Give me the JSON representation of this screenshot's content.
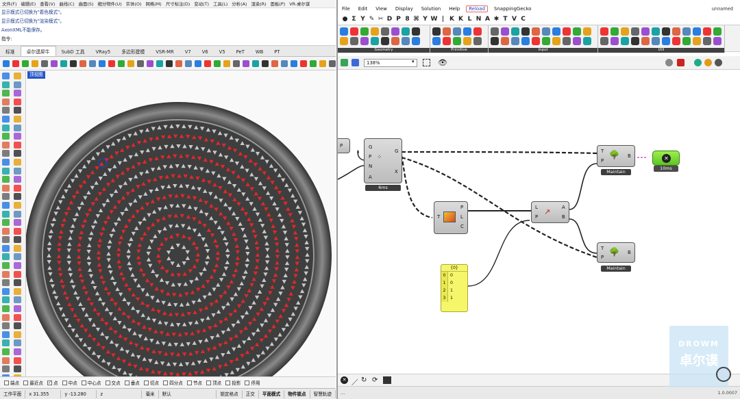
{
  "rhino": {
    "menu": [
      "文件(F)",
      "编辑(E)",
      "查看(V)",
      "曲线(C)",
      "曲面(S)",
      "细分物件(U)",
      "实体(O)",
      "网格(M)",
      "尺寸标注(D)",
      "变动(T)",
      "工具(L)",
      "分析(A)",
      "渲染(R)",
      "面板(P)",
      "VR-桌尔谋"
    ],
    "command_history": [
      "显示模式已切换为\"着色模式\"。",
      "显示模式已切换为\"渲染模式\"。",
      "AxonXML不能保存。"
    ],
    "command_prompt": "指令:",
    "tabs": [
      "标准",
      "卓尔谟犀牛",
      "SubD 工具",
      "VRay5",
      "多边形建模",
      "VSR-MR",
      "V7",
      "V6",
      "V5",
      "PeT",
      "WB",
      "PT"
    ],
    "active_tab": "卓尔谟犀牛",
    "viewport_label": "顶视图",
    "osnaps": [
      {
        "label": "端点",
        "checked": false
      },
      {
        "label": "最近点",
        "checked": false
      },
      {
        "label": "点",
        "checked": true
      },
      {
        "label": "中点",
        "checked": false
      },
      {
        "label": "中心点",
        "checked": false
      },
      {
        "label": "交点",
        "checked": false
      },
      {
        "label": "垂点",
        "checked": false
      },
      {
        "label": "切点",
        "checked": false
      },
      {
        "label": "四分点",
        "checked": false
      },
      {
        "label": "节点",
        "checked": false
      },
      {
        "label": "顶点",
        "checked": false
      },
      {
        "label": "投影",
        "checked": false
      },
      {
        "label": "停用",
        "checked": false
      }
    ],
    "status": {
      "cplane": "工作平面",
      "x": "x 31.355",
      "y": "y -13.280",
      "z": "z",
      "units": "毫米",
      "layer": "默认",
      "items": [
        "锁定格点",
        "正交",
        "平面模式",
        "物件锁点",
        "智慧轨迹"
      ]
    }
  },
  "gh": {
    "menu": [
      "File",
      "Edit",
      "View",
      "Display",
      "Solution",
      "Help",
      "Reload",
      "SnappingGecko"
    ],
    "doc_name": "unnamed",
    "comp_tabs": [
      "●",
      "Σ",
      "Y",
      "✎",
      "✂",
      "D",
      "P",
      "8",
      "⌘",
      "Y",
      "W",
      "|",
      "K",
      "K",
      "L",
      "N",
      "A",
      "✱",
      "T",
      "V",
      "C"
    ],
    "panels": [
      "Geometry",
      "Primitive",
      "Input",
      "Util"
    ],
    "zoom": "138%",
    "version": "1.0.0007",
    "footer_dots": "...",
    "components": {
      "pop": {
        "inputs": [
          "G",
          "P",
          "N",
          "A"
        ],
        "outputs": [
          "G",
          "X"
        ],
        "time": "6ms"
      },
      "gradient": {
        "inputs": [
          "T"
        ],
        "outputs": [
          "P",
          "L",
          "C"
        ]
      },
      "pick": {
        "inputs": [
          "L",
          "P"
        ],
        "outputs": [
          "A",
          "B"
        ]
      },
      "maintain1": {
        "inputs": [
          "T",
          "P"
        ],
        "outputs": [
          "B"
        ],
        "caption": "Maintain"
      },
      "maintain2": {
        "inputs": [
          "T",
          "P"
        ],
        "outputs": [
          "B"
        ],
        "caption": "Maintain"
      },
      "timer": {
        "time": "10ms"
      },
      "partial": {
        "input": "P"
      }
    },
    "panel": {
      "header": "{0}",
      "rows": [
        {
          "i": "0",
          "v": "0"
        },
        {
          "i": "1",
          "v": "0"
        },
        {
          "i": "2",
          "v": "1"
        },
        {
          "i": "3",
          "v": "1"
        }
      ]
    }
  },
  "watermark": {
    "line1": "DROWM",
    "line2": "卓尔谟"
  }
}
